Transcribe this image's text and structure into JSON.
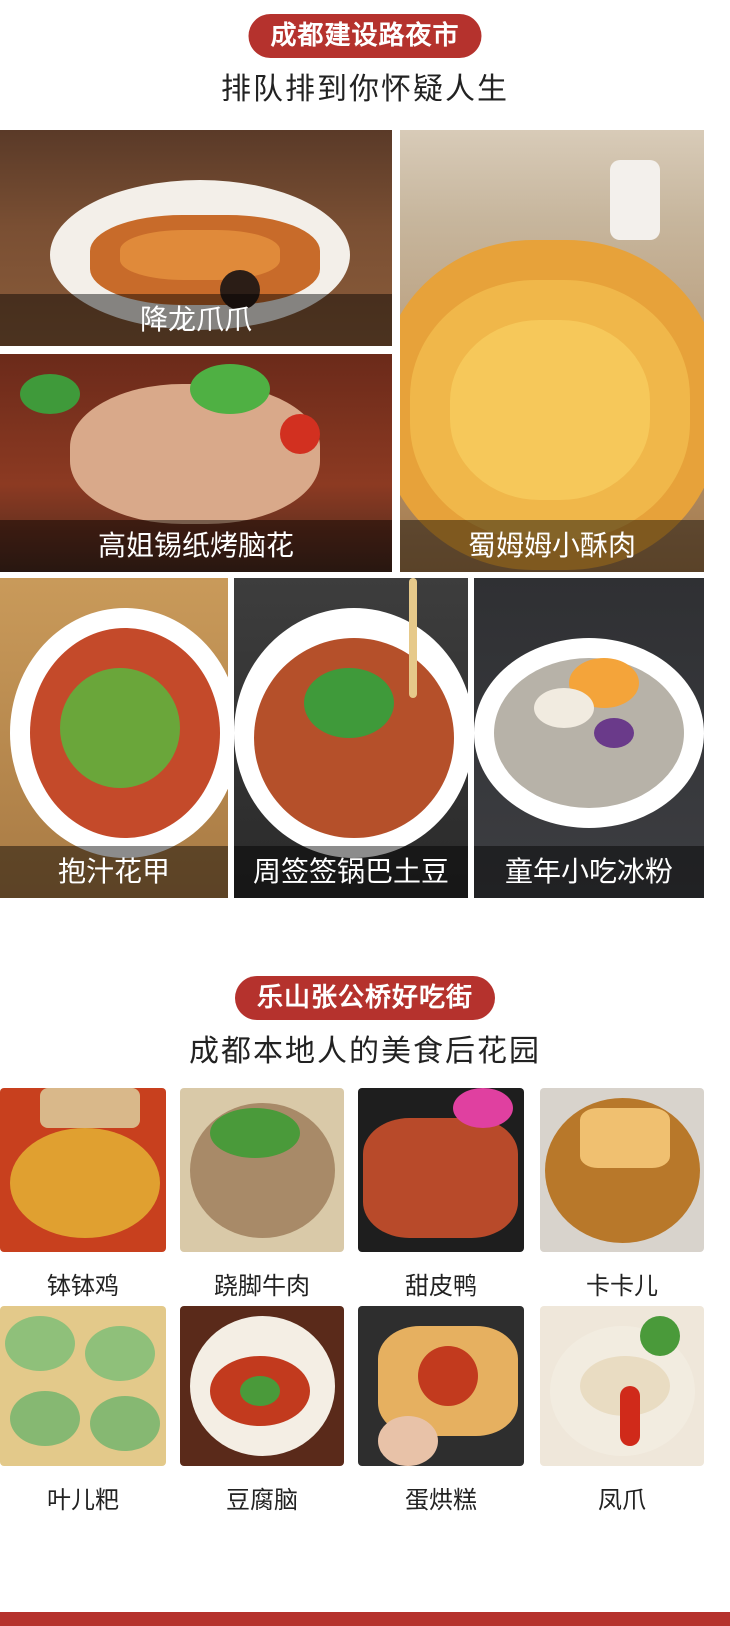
{
  "section1": {
    "badge": "成都建设路夜市",
    "subtitle": "排队排到你怀疑人生",
    "items": [
      {
        "caption": "降龙爪爪"
      },
      {
        "caption": "蜀姆姆小酥肉"
      },
      {
        "caption": "高姐锡纸烤脑花"
      },
      {
        "caption": "抱汁花甲"
      },
      {
        "caption": "周签签锅巴土豆"
      },
      {
        "caption": "童年小吃冰粉"
      }
    ]
  },
  "section2": {
    "badge": "乐山张公桥好吃街",
    "subtitle": "成都本地人的美食后花园",
    "items": [
      {
        "label": "钵钵鸡"
      },
      {
        "label": "跷脚牛肉"
      },
      {
        "label": "甜皮鸭"
      },
      {
        "label": "卡卡儿"
      },
      {
        "label": "叶儿粑"
      },
      {
        "label": "豆腐脑"
      },
      {
        "label": "蛋烘糕"
      },
      {
        "label": "凤爪"
      }
    ]
  },
  "colors": {
    "accent": "#b5322d",
    "background": "#ffffff"
  }
}
